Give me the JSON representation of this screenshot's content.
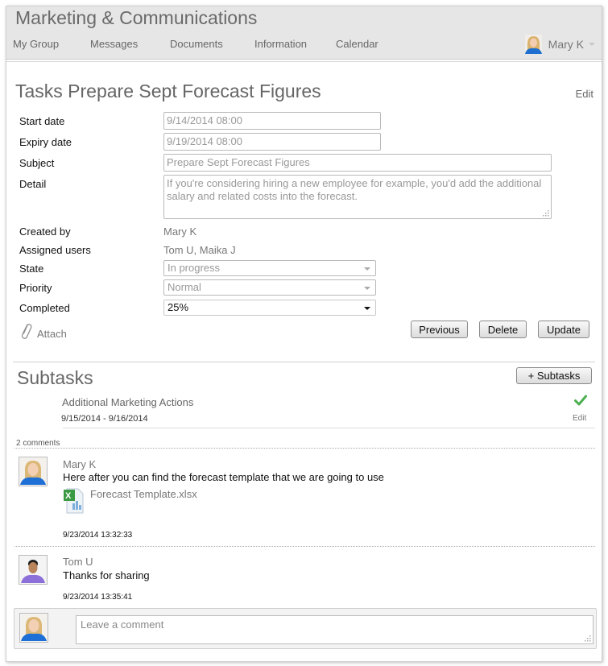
{
  "app": {
    "title": "Marketing & Communications",
    "nav": [
      {
        "label": "My Group"
      },
      {
        "label": "Messages"
      },
      {
        "label": "Documents"
      },
      {
        "label": "Information"
      },
      {
        "label": "Calendar"
      }
    ],
    "user": {
      "name": "Mary K"
    }
  },
  "task": {
    "title": "Tasks Prepare Sept Forecast Figures",
    "edit_label": "Edit",
    "fields": {
      "start_date": {
        "label": "Start date",
        "value": "9/14/2014 08:00"
      },
      "expiry_date": {
        "label": "Expiry date",
        "value": "9/19/2014 08:00"
      },
      "subject": {
        "label": "Subject",
        "value": "Prepare Sept Forecast Figures"
      },
      "detail": {
        "label": "Detail",
        "value": "If you're considering hiring a new employee for example, you'd add the additional salary and related costs into the forecast."
      },
      "created_by": {
        "label": "Created by",
        "value": "Mary K"
      },
      "assigned_users": {
        "label": "Assigned users",
        "value": "Tom U, Maika J"
      },
      "state": {
        "label": "State",
        "value": "In progress"
      },
      "priority": {
        "label": "Priority",
        "value": "Normal"
      },
      "completed": {
        "label": "Completed",
        "value": "25%"
      }
    },
    "attach_label": "Attach",
    "buttons": {
      "previous": "Previous",
      "delete": "Delete",
      "update": "Update"
    }
  },
  "subtasks": {
    "title": "Subtasks",
    "add_label": "+ Subtasks",
    "items": [
      {
        "name": "Additional Marketing Actions",
        "dates": "9/15/2014 - 9/16/2014",
        "done": true,
        "edit_label": "Edit"
      }
    ]
  },
  "comments": {
    "count_label": "2 comments",
    "items": [
      {
        "author": "Mary K",
        "text": "Here after you can find the forecast template that we are going to use",
        "attachment": "Forecast Template.xlsx",
        "time": "9/23/2014 13:32:33"
      },
      {
        "author": "Tom U",
        "text": "Thanks for sharing",
        "time": "9/23/2014 13:35:41"
      }
    ],
    "new_comment_placeholder": "Leave a comment"
  },
  "colors": {
    "header_bg": "#e6e6e6",
    "check_green": "#4caf50",
    "excel_green": "#2e8b3a"
  }
}
